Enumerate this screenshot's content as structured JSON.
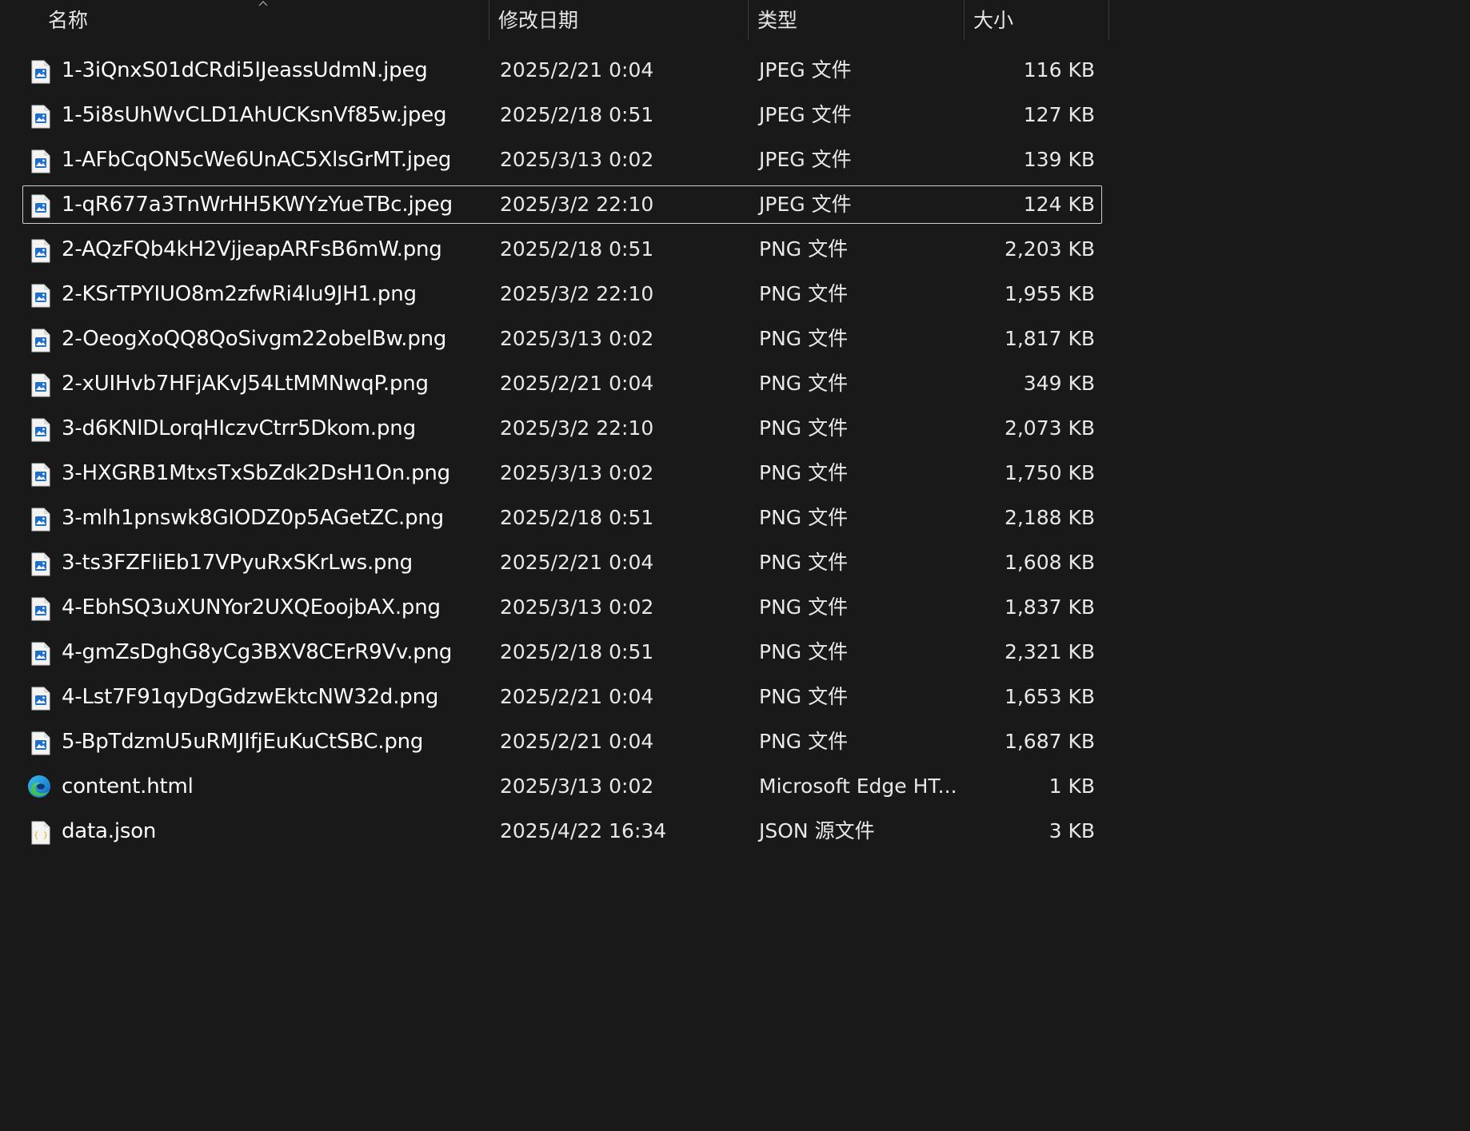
{
  "columns": {
    "name": "名称",
    "date": "修改日期",
    "type": "类型",
    "size": "大小"
  },
  "sort": {
    "column": "name",
    "direction": "ascending"
  },
  "colors": {
    "background": "#191919",
    "focus_border": "#cfcfcf",
    "image_icon_accent": "#1f6fd1",
    "json_icon_accent": "#d9b300"
  },
  "files": [
    {
      "name": "1-3iQnxS01dCRdi5IJeassUdmN.jpeg",
      "date": "2025/2/21 0:04",
      "type": "JPEG 文件",
      "size": "116 KB",
      "icon": "image-file-icon",
      "focused": false
    },
    {
      "name": "1-5i8sUhWvCLD1AhUCKsnVf85w.jpeg",
      "date": "2025/2/18 0:51",
      "type": "JPEG 文件",
      "size": "127 KB",
      "icon": "image-file-icon",
      "focused": false
    },
    {
      "name": "1-AFbCqON5cWe6UnAC5XlsGrMT.jpeg",
      "date": "2025/3/13 0:02",
      "type": "JPEG 文件",
      "size": "139 KB",
      "icon": "image-file-icon",
      "focused": false
    },
    {
      "name": "1-qR677a3TnWrHH5KWYzYueTBc.jpeg",
      "date": "2025/3/2 22:10",
      "type": "JPEG 文件",
      "size": "124 KB",
      "icon": "image-file-icon",
      "focused": true
    },
    {
      "name": "2-AQzFQb4kH2VjjeapARFsB6mW.png",
      "date": "2025/2/18 0:51",
      "type": "PNG 文件",
      "size": "2,203 KB",
      "icon": "image-file-icon",
      "focused": false
    },
    {
      "name": "2-KSrTPYIUO8m2zfwRi4lu9JH1.png",
      "date": "2025/3/2 22:10",
      "type": "PNG 文件",
      "size": "1,955 KB",
      "icon": "image-file-icon",
      "focused": false
    },
    {
      "name": "2-OeogXoQQ8QoSivgm22obelBw.png",
      "date": "2025/3/13 0:02",
      "type": "PNG 文件",
      "size": "1,817 KB",
      "icon": "image-file-icon",
      "focused": false
    },
    {
      "name": "2-xUIHvb7HFjAKvJ54LtMMNwqP.png",
      "date": "2025/2/21 0:04",
      "type": "PNG 文件",
      "size": "349 KB",
      "icon": "image-file-icon",
      "focused": false
    },
    {
      "name": "3-d6KNlDLorqHIczvCtrr5Dkom.png",
      "date": "2025/3/2 22:10",
      "type": "PNG 文件",
      "size": "2,073 KB",
      "icon": "image-file-icon",
      "focused": false
    },
    {
      "name": "3-HXGRB1MtxsTxSbZdk2DsH1On.png",
      "date": "2025/3/13 0:02",
      "type": "PNG 文件",
      "size": "1,750 KB",
      "icon": "image-file-icon",
      "focused": false
    },
    {
      "name": "3-mlh1pnswk8GIODZ0p5AGetZC.png",
      "date": "2025/2/18 0:51",
      "type": "PNG 文件",
      "size": "2,188 KB",
      "icon": "image-file-icon",
      "focused": false
    },
    {
      "name": "3-ts3FZFIiEb17VPyuRxSKrLws.png",
      "date": "2025/2/21 0:04",
      "type": "PNG 文件",
      "size": "1,608 KB",
      "icon": "image-file-icon",
      "focused": false
    },
    {
      "name": "4-EbhSQ3uXUNYor2UXQEoojbAX.png",
      "date": "2025/3/13 0:02",
      "type": "PNG 文件",
      "size": "1,837 KB",
      "icon": "image-file-icon",
      "focused": false
    },
    {
      "name": "4-gmZsDghG8yCg3BXV8CErR9Vv.png",
      "date": "2025/2/18 0:51",
      "type": "PNG 文件",
      "size": "2,321 KB",
      "icon": "image-file-icon",
      "focused": false
    },
    {
      "name": "4-Lst7F91qyDgGdzwEktcNW32d.png",
      "date": "2025/2/21 0:04",
      "type": "PNG 文件",
      "size": "1,653 KB",
      "icon": "image-file-icon",
      "focused": false
    },
    {
      "name": "5-BpTdzmU5uRMJIfjEuKuCtSBC.png",
      "date": "2025/2/21 0:04",
      "type": "PNG 文件",
      "size": "1,687 KB",
      "icon": "image-file-icon",
      "focused": false
    },
    {
      "name": "content.html",
      "date": "2025/3/13 0:02",
      "type": "Microsoft Edge HT...",
      "size": "1 KB",
      "icon": "edge-browser-icon",
      "focused": false
    },
    {
      "name": "data.json",
      "date": "2025/4/22 16:34",
      "type": "JSON 源文件",
      "size": "3 KB",
      "icon": "json-file-icon",
      "focused": false
    }
  ]
}
